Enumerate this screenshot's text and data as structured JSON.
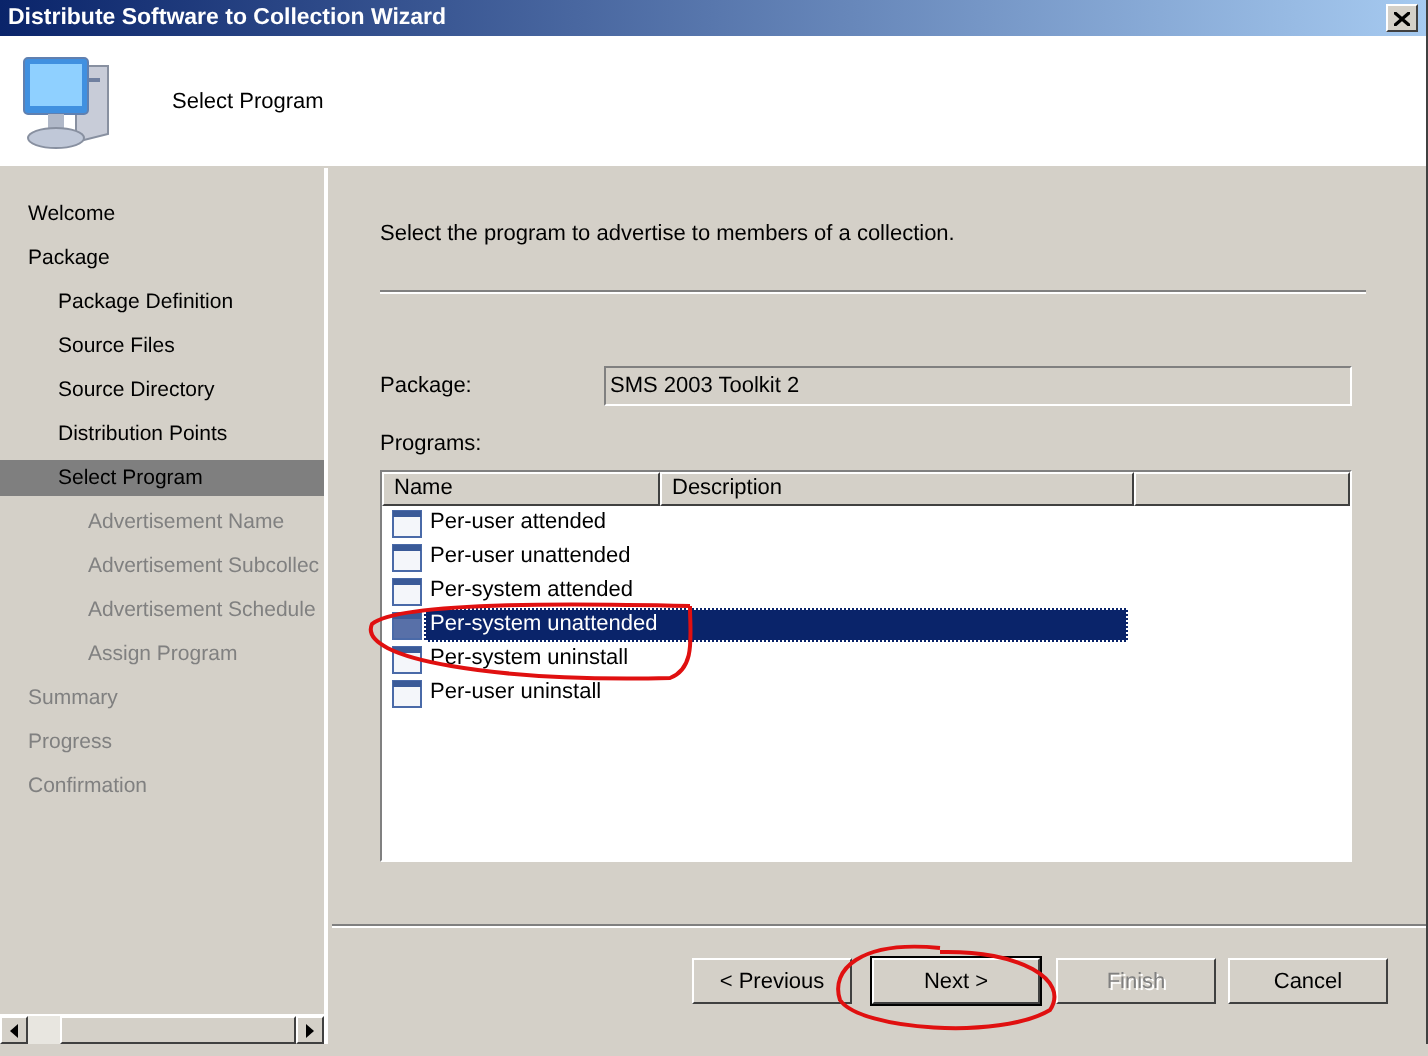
{
  "window": {
    "title": "Distribute Software to Collection Wizard"
  },
  "header": {
    "title": "Select Program"
  },
  "sidebar": {
    "items": [
      {
        "label": "Welcome",
        "selected": false,
        "disabled": false
      },
      {
        "label": "Package",
        "selected": false,
        "disabled": false,
        "children": [
          {
            "label": "Package Definition",
            "selected": false,
            "disabled": false
          },
          {
            "label": "Source Files",
            "selected": false,
            "disabled": false
          },
          {
            "label": "Source Directory",
            "selected": false,
            "disabled": false
          },
          {
            "label": "Distribution Points",
            "selected": false,
            "disabled": false
          },
          {
            "label": "Select Program",
            "selected": true,
            "disabled": false,
            "children": [
              {
                "label": "Advertisement Name",
                "selected": false,
                "disabled": true
              },
              {
                "label": "Advertisement Subcollec",
                "selected": false,
                "disabled": true
              },
              {
                "label": "Advertisement Schedule",
                "selected": false,
                "disabled": true
              },
              {
                "label": "Assign Program",
                "selected": false,
                "disabled": true
              }
            ]
          }
        ]
      },
      {
        "label": "Summary",
        "selected": false,
        "disabled": true
      },
      {
        "label": "Progress",
        "selected": false,
        "disabled": true
      },
      {
        "label": "Confirmation",
        "selected": false,
        "disabled": true
      }
    ]
  },
  "instruction": "Select the program to advertise to members of a collection.",
  "package": {
    "label": "Package:",
    "value": "SMS 2003 Toolkit 2"
  },
  "programs": {
    "label": "Programs:",
    "columns": [
      "Name",
      "Description"
    ],
    "rows": [
      {
        "name": "Per-user attended",
        "selected": false
      },
      {
        "name": "Per-user unattended",
        "selected": false
      },
      {
        "name": "Per-system attended",
        "selected": false
      },
      {
        "name": "Per-system unattended",
        "selected": true
      },
      {
        "name": "Per-system uninstall",
        "selected": false
      },
      {
        "name": "Per-user uninstall",
        "selected": false
      }
    ]
  },
  "buttons": [
    {
      "label": "< Previous",
      "default": false,
      "disabled": false
    },
    {
      "label": "Next >",
      "default": true,
      "disabled": false
    },
    {
      "label": "Finish",
      "default": false,
      "disabled": true
    },
    {
      "label": "Cancel",
      "default": false,
      "disabled": false
    }
  ]
}
